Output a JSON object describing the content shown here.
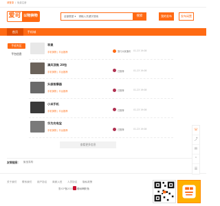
{
  "colors": {
    "accent": "#ff6a13",
    "accent_dark": "#e04d00"
  },
  "topbar": {
    "login": "请登录",
    "sep": "/",
    "register": "免费注册"
  },
  "brand": {
    "main": "爱可",
    "sub": "以物换物"
  },
  "search": {
    "category": "全部类型 ▾",
    "placeholder": "请输入关键字搜索",
    "button": "搜索",
    "actions": [
      "我的发布",
      "发布闲置"
    ]
  },
  "nav": [
    {
      "label": "首页",
      "active": true
    },
    {
      "label": "手机城",
      "active": false
    }
  ],
  "sidebar": [
    {
      "label": "手机专区",
      "active": true
    },
    {
      "label": "平台信息",
      "active": false
    }
  ],
  "listings": [
    {
      "title": "苹果",
      "meta": "手机换物 | 平台推荐",
      "seller": "旅行大家通讯",
      "date": "01-23 19:08",
      "thumb_color": "#e8e8e8",
      "avatar_color": "#ff6a13"
    },
    {
      "title": "清风顶焦 20包",
      "meta": "手机换物 | 平台推荐",
      "seller": "已推荐",
      "date": "01-23 19:08",
      "thumb_color": "#6b625a",
      "avatar_color": "#b03050"
    },
    {
      "title": "头部按摩器",
      "meta": "手机换物 | 平台推荐",
      "seller": "已推荐",
      "date": "01-23 19:08",
      "thumb_color": "#6a6a6a",
      "avatar_color": "#b03050"
    },
    {
      "title": "小米手机",
      "meta": "手机换物 | 平台推荐",
      "seller": "已推荐",
      "date": "01-23 19:08",
      "thumb_color": "#3a3a3a",
      "avatar_color": "#b03050"
    },
    {
      "title": "华为充电宝",
      "meta": "手机换物 | 平台推荐",
      "seller": "已推荐",
      "date": "01-23 19:08",
      "thumb_color": "#7a7a7a",
      "avatar_color": "#b03050"
    }
  ],
  "more_button": "查看更多信息",
  "friend_links": {
    "title": "友情链接：",
    "item": "聚宝易购"
  },
  "footer": {
    "links": [
      "关于我们",
      "联系我们",
      "用户协议",
      "商家入驻",
      "人员协议",
      "隐私政策"
    ],
    "icp": "鲁ICP备2021044345号",
    "icp_suffix": "鲁公网安备"
  },
  "float_bar": [
    "phone-icon",
    "share-icon",
    "message-icon",
    "chevron-up-icon",
    "chat-icon"
  ]
}
